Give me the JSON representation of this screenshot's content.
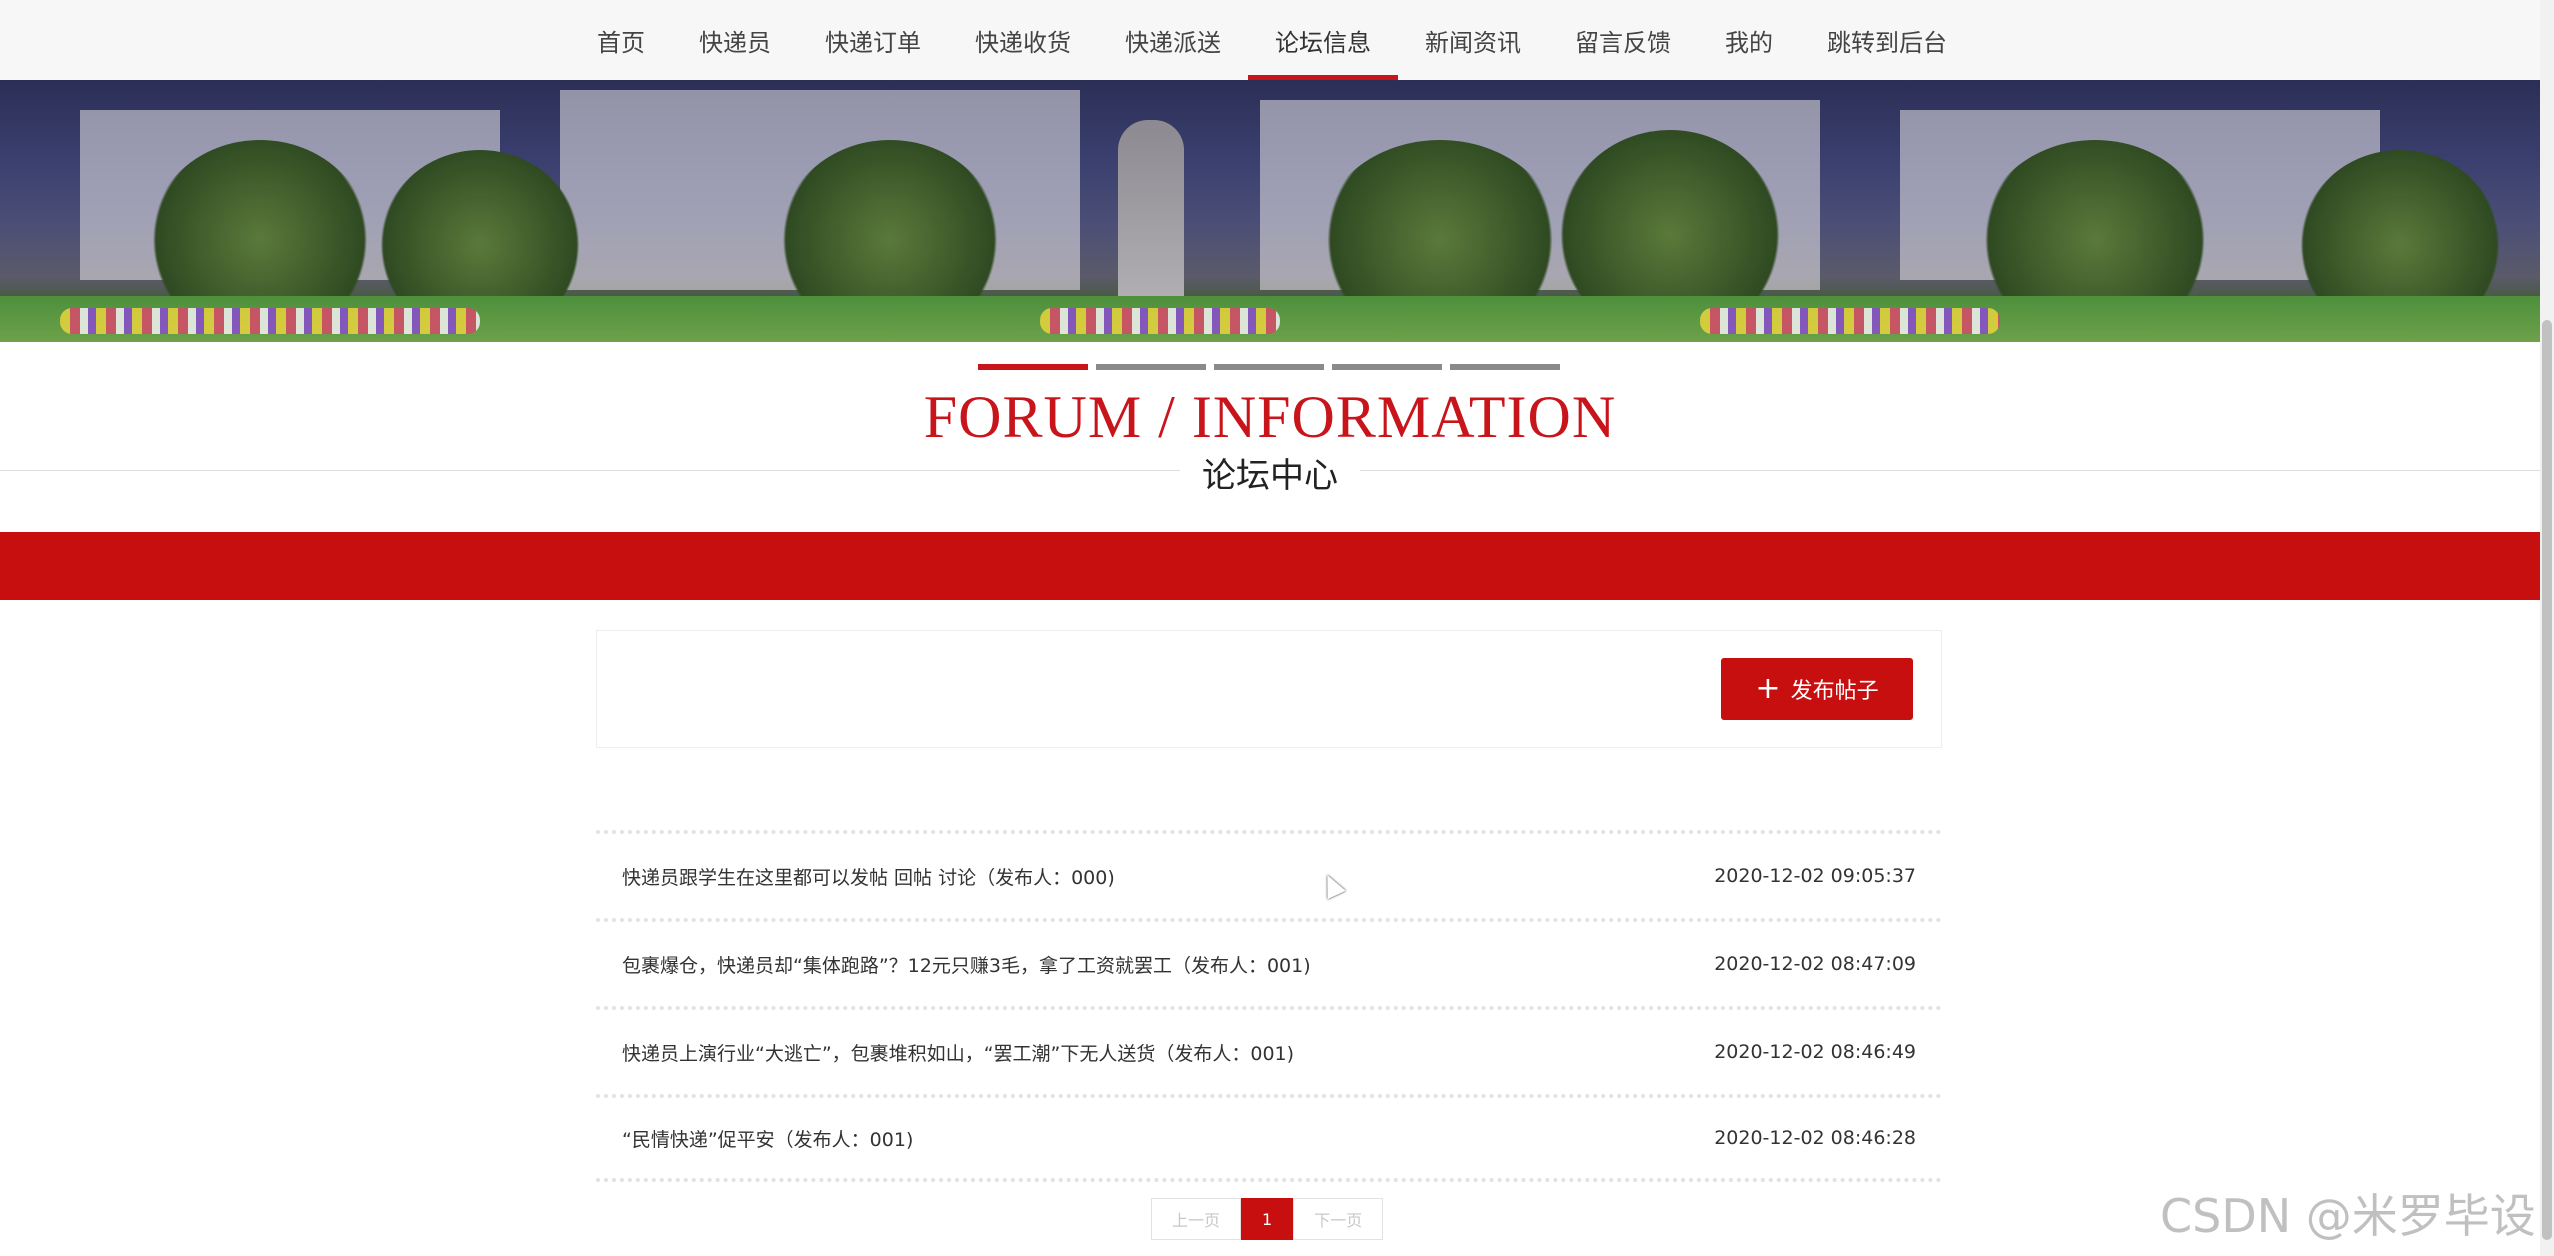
{
  "nav": {
    "items": [
      {
        "label": "首页"
      },
      {
        "label": "快递员"
      },
      {
        "label": "快递订单"
      },
      {
        "label": "快递收货"
      },
      {
        "label": "快递派送"
      },
      {
        "label": "论坛信息"
      },
      {
        "label": "新闻资讯"
      },
      {
        "label": "留言反馈"
      },
      {
        "label": "我的"
      },
      {
        "label": "跳转到后台"
      }
    ],
    "active_index": 5
  },
  "hero": {
    "slides_total": 5,
    "active_slide": 1
  },
  "section": {
    "title_en": "FORUM / INFORMATION",
    "title_cn": "论坛中心"
  },
  "actions": {
    "post_button": "发布帖子",
    "post_icon": "plus-icon"
  },
  "posts": [
    {
      "title": "快递员跟学生在这里都可以发帖 回帖 讨论（发布人：000)",
      "date": "2020-12-02 09:05:37"
    },
    {
      "title": "包裹爆仓，快递员却“集体跑路”？12元只赚3毛，拿了工资就罢工（发布人：001)",
      "date": "2020-12-02 08:47:09"
    },
    {
      "title": "快递员上演行业“大逃亡”，包裹堆积如山，“罢工潮”下无人送货（发布人：001)",
      "date": "2020-12-02 08:46:49"
    },
    {
      "title": "“民情快递”促平安（发布人：001)",
      "date": "2020-12-02 08:46:28"
    }
  ],
  "pagination": {
    "prev": "上一页",
    "current": "1",
    "next": "下一页"
  },
  "watermark": "CSDN @米罗毕设",
  "colors": {
    "accent": "#c80f0f",
    "nav_bg": "#f7f7f7"
  }
}
